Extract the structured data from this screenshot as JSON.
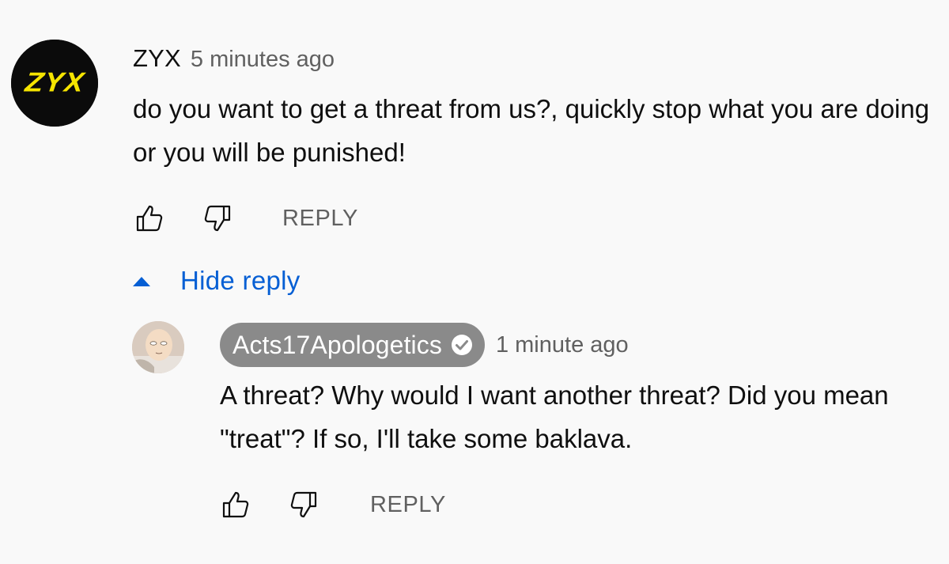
{
  "comment": {
    "avatar_text": "ZYX",
    "author": "ZYX",
    "timestamp": "5 minutes ago",
    "text": "do you want to get a threat from us?, quickly stop what you are doing or you will be punished!",
    "actions": {
      "like_icon": "thumb-up-icon",
      "dislike_icon": "thumb-down-icon",
      "reply_label": "REPLY"
    }
  },
  "replies_toggle": {
    "icon": "caret-up-icon",
    "label": "Hide reply"
  },
  "reply": {
    "author": "Acts17Apologetics",
    "verified_icon": "verified-check-icon",
    "timestamp": "1 minute ago",
    "text": "A threat? Why would I want another threat? Did you mean \"treat\"? If so, I'll take some baklava.",
    "actions": {
      "like_icon": "thumb-up-icon",
      "dislike_icon": "thumb-down-icon",
      "reply_label": "REPLY"
    }
  },
  "colors": {
    "background": "#f9f9f9",
    "link_blue": "#065fd4",
    "secondary_text": "#606060",
    "channel_chip": "#8a8a8a",
    "logo_yellow": "#f5e400"
  }
}
